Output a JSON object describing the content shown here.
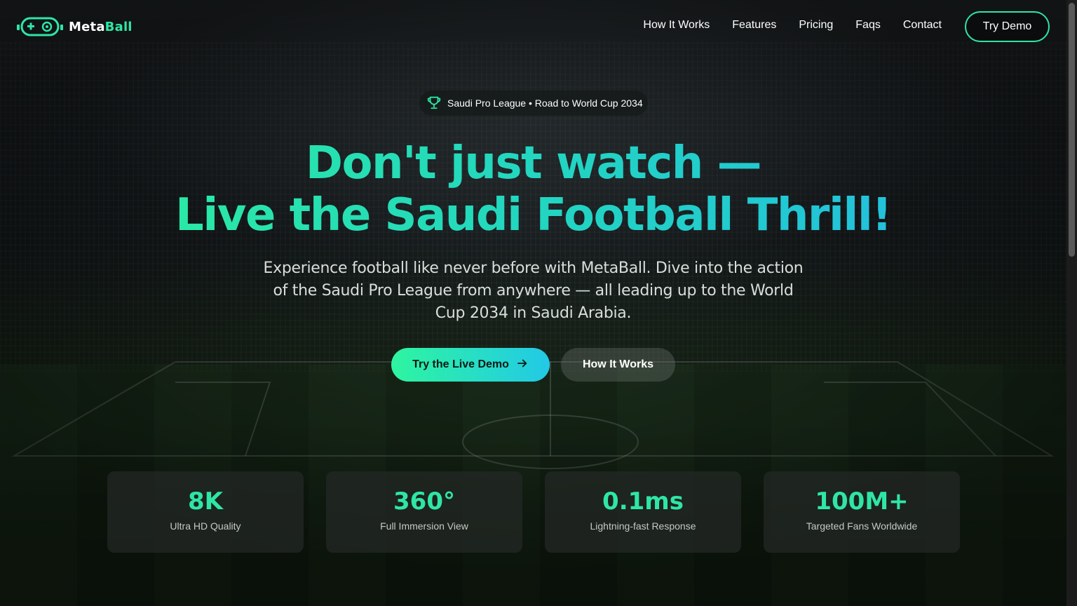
{
  "brand": {
    "name_prefix": "Meta",
    "name_suffix": "Ball",
    "logo_icon": "gamepad-icon",
    "accent": "#2ee6a6"
  },
  "nav": {
    "items": [
      {
        "label": "How It Works"
      },
      {
        "label": "Features"
      },
      {
        "label": "Pricing"
      },
      {
        "label": "Faqs"
      },
      {
        "label": "Contact"
      }
    ],
    "cta_label": "Try Demo"
  },
  "hero": {
    "badge_icon": "trophy-icon",
    "badge_text": "Saudi Pro League • Road to World Cup 2034",
    "headline_line1": "Don't just watch —",
    "headline_line2": "Live the Saudi Football Thrill!",
    "subtitle": "Experience football like never before with MetaBall. Dive into the action of the Saudi Pro League from anywhere — all leading up to the World Cup 2034 in Saudi Arabia.",
    "primary_button": "Try the Live Demo",
    "primary_button_icon": "arrow-right-icon",
    "secondary_button": "How It Works",
    "gradient": [
      "#2ef09a",
      "#23b8e8"
    ]
  },
  "stats": [
    {
      "value": "8K",
      "label": "Ultra HD Quality"
    },
    {
      "value": "360°",
      "label": "Full Immersion View"
    },
    {
      "value": "0.1ms",
      "label": "Lightning-fast Response"
    },
    {
      "value": "100M+",
      "label": "Targeted Fans Worldwide"
    }
  ]
}
